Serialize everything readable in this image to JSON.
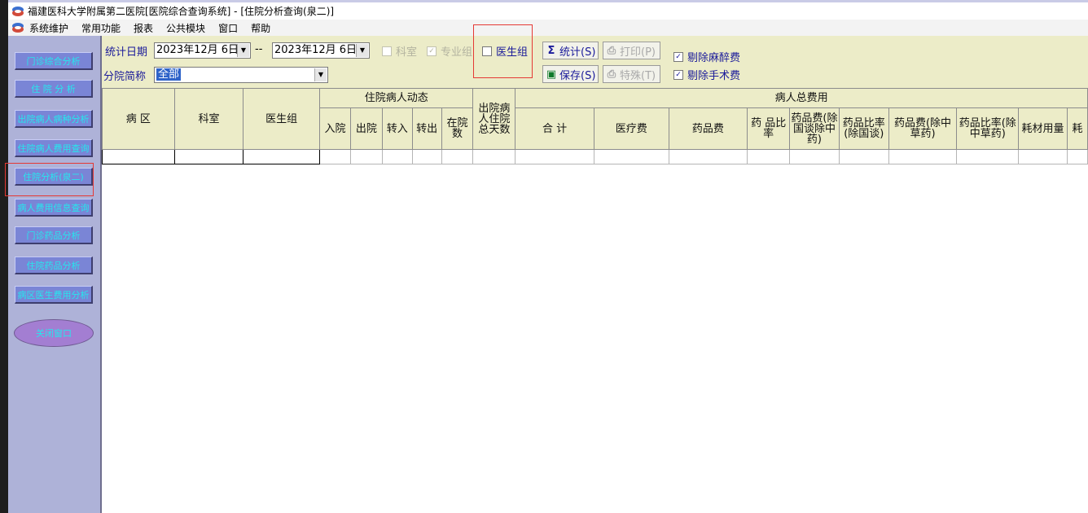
{
  "titlebar": {
    "title": "福建医科大学附属第二医院[医院综合查询系统] - [住院分析查询(泉二)]"
  },
  "menubar": {
    "items": [
      "系统维护",
      "常用功能",
      "报表",
      "公共模块",
      "窗口",
      "帮助"
    ]
  },
  "sidebar": {
    "items": [
      {
        "label": "门诊综合分析"
      },
      {
        "label": "住 院 分 析"
      },
      {
        "label": "出院病人病种分析"
      },
      {
        "label": "住院病人费用查询"
      },
      {
        "label": "住院分析(泉二)"
      },
      {
        "label": "病人费用信息查询"
      },
      {
        "label": "门诊药品分析"
      },
      {
        "label": "住院药品分析"
      },
      {
        "label": "病区医生费用分析"
      },
      {
        "label": "关闭窗口"
      }
    ]
  },
  "filters": {
    "date_label": "统计日期",
    "date_from": "2023年12月 6日",
    "date_sep": "--",
    "date_to": "2023年12月 6日",
    "dept_checkbox": "科室",
    "specialty_checkbox": "专业组",
    "doctor_group_checkbox": "医生组",
    "branch_label": "分院简称",
    "branch_value": "全部",
    "stat_button": "统计(S)",
    "print_button": "打印(P)",
    "save_button": "保存(S)",
    "special_button": "特殊(T)",
    "exclude_anesthesia": "剔除麻醉费",
    "exclude_surgery": "剔除手术费"
  },
  "grid": {
    "headers": {
      "ward": "病 区",
      "dept": "科室",
      "doctor_group": "医生组",
      "dynamic_group": "住院病人动态",
      "admit": "入院",
      "discharge": "出院",
      "transfer_in": "转入",
      "transfer_out": "转出",
      "in_hospital": "在院数",
      "discharge_days": "出院病人住院总天数",
      "total_fee_group": "病人总费用",
      "total": "合 计",
      "medical_fee": "医疗费",
      "drug_fee": "药品费",
      "drug_ratio": "药 品比 率",
      "drug_fee_excl_natl": "药品费(除国谈除中药)",
      "drug_ratio_excl_natl": "药品比率(除国谈)",
      "drug_fee_excl_herbal": "药品费(除中草药)",
      "drug_ratio_excl_herbal": "药品比率(除中草药)",
      "consumables": "耗材用量",
      "more": "耗"
    }
  },
  "colors": {
    "sidebar_bg": "#aeb2d8",
    "nav_button": "#7a85d6",
    "nav_text": "#25e8ee",
    "panel_bg": "#ececc8",
    "highlight_box": "#e53935"
  }
}
